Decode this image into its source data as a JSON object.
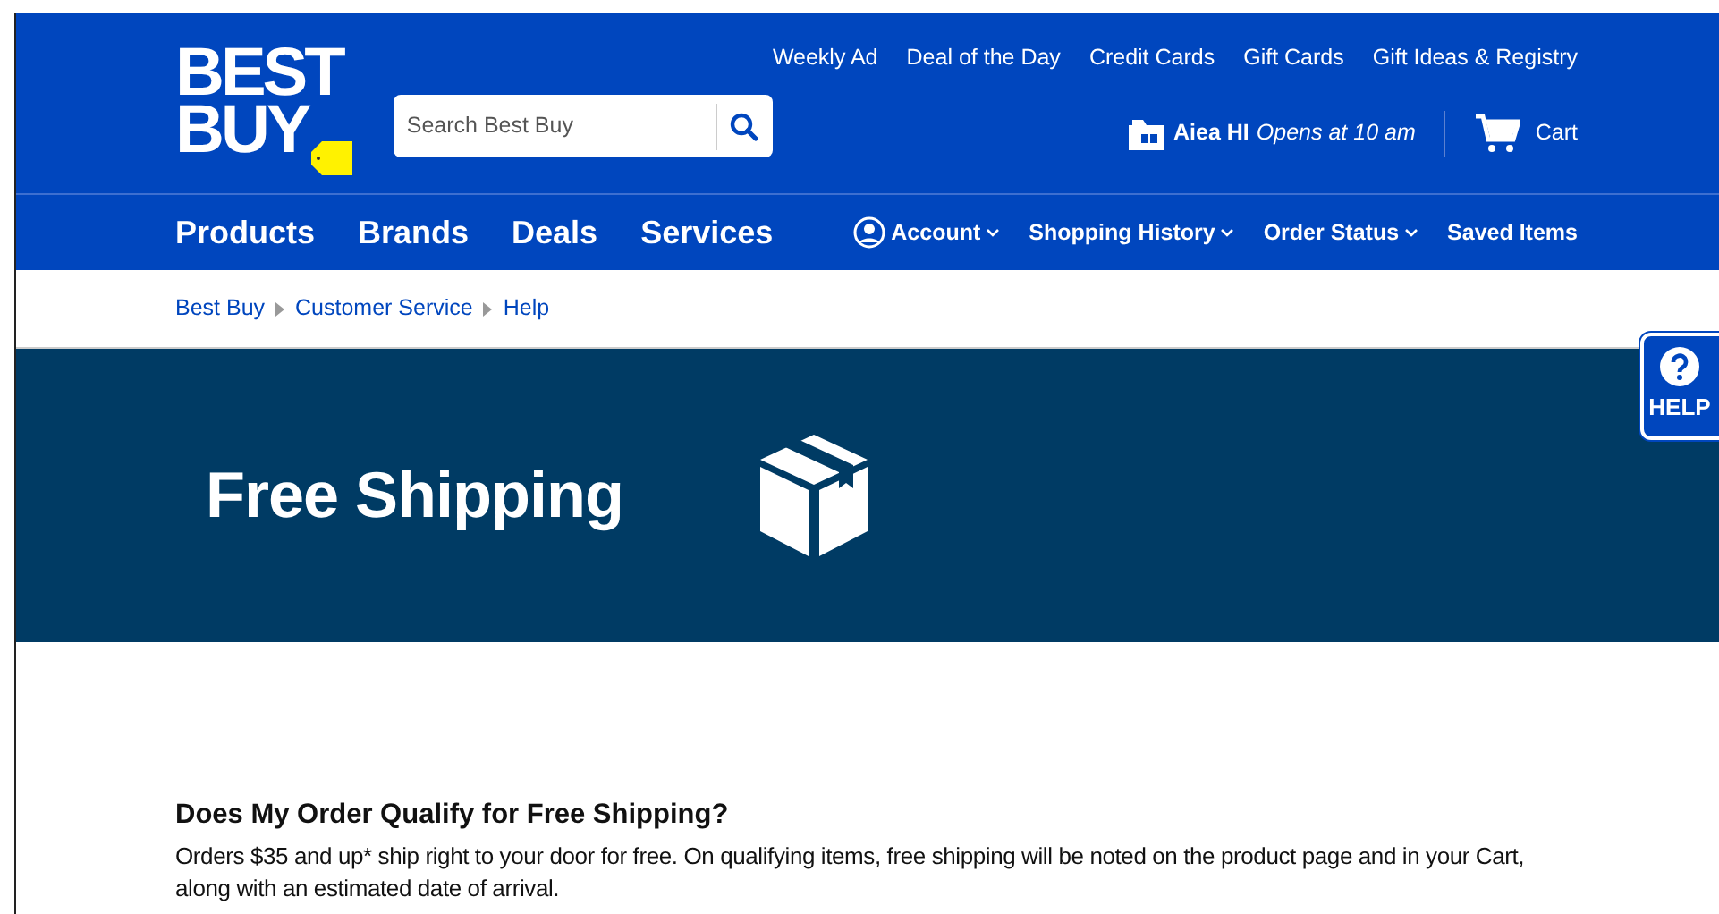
{
  "logo": {
    "lines": [
      "BEST",
      "BUY"
    ]
  },
  "utility_links": [
    "Weekly Ad",
    "Deal of the Day",
    "Credit Cards",
    "Gift Cards",
    "Gift Ideas & Registry"
  ],
  "search": {
    "placeholder": "Search Best Buy"
  },
  "store": {
    "name": "Aiea HI",
    "hours": "Opens at 10 am"
  },
  "cart": {
    "label": "Cart"
  },
  "main_nav": [
    "Products",
    "Brands",
    "Deals",
    "Services"
  ],
  "account_nav": [
    {
      "label": "Account",
      "kind": "account"
    },
    {
      "label": "Shopping History",
      "kind": "dropdown"
    },
    {
      "label": "Order Status",
      "kind": "dropdown"
    },
    {
      "label": "Saved Items",
      "kind": "link"
    }
  ],
  "breadcrumb": [
    "Best Buy",
    "Customer Service",
    "Help"
  ],
  "banner": {
    "title": "Free Shipping"
  },
  "help_tab": {
    "label": "HELP"
  },
  "sections": [
    {
      "heading": "Does My Order Qualify for Free Shipping?",
      "text": "Orders $35 and up* ship right to your door for free. On qualifying items, free shipping will be noted on the product page and in your Cart, along with an estimated date of arrival."
    }
  ]
}
